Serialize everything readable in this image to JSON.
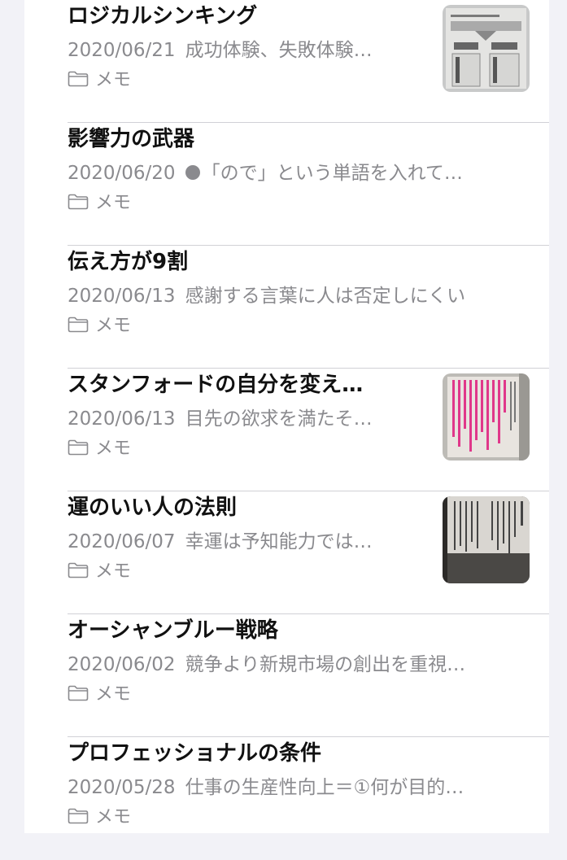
{
  "notes": [
    {
      "title": "ロジカルシンキング",
      "date": "2020/06/21",
      "snippet": "成功体験、失敗体験…",
      "folder": "メモ",
      "has_dot": false,
      "thumbnail": "thumb-diagram"
    },
    {
      "title": "影響力の武器",
      "date": "2020/06/20",
      "snippet": "「ので」という単語を入れて…",
      "folder": "メモ",
      "has_dot": true,
      "thumbnail": null
    },
    {
      "title": "伝え方が9割",
      "date": "2020/06/13",
      "snippet": "感謝する言葉に人は否定しにくい",
      "folder": "メモ",
      "has_dot": false,
      "thumbnail": null
    },
    {
      "title": "スタンフォードの自分を変え…",
      "date": "2020/06/13",
      "snippet": "目先の欲求を満たそ…",
      "folder": "メモ",
      "has_dot": false,
      "thumbnail": "thumb-highlighted"
    },
    {
      "title": "運のいい人の法則",
      "date": "2020/06/07",
      "snippet": "幸運は予知能力では…",
      "folder": "メモ",
      "has_dot": false,
      "thumbnail": "thumb-book"
    },
    {
      "title": "オーシャンブルー戦略",
      "date": "2020/06/02",
      "snippet": "競争より新規市場の創出を重視…",
      "folder": "メモ",
      "has_dot": false,
      "thumbnail": null
    },
    {
      "title": "プロフェッショナルの条件",
      "date": "2020/05/28",
      "snippet": "仕事の生産性向上＝①何が目的…",
      "folder": "メモ",
      "has_dot": false,
      "thumbnail": null
    }
  ],
  "colors": {
    "title": "#111111",
    "secondary": "#8a8a8e",
    "separator": "#d1d1d6",
    "background": "#f2f2f7"
  }
}
